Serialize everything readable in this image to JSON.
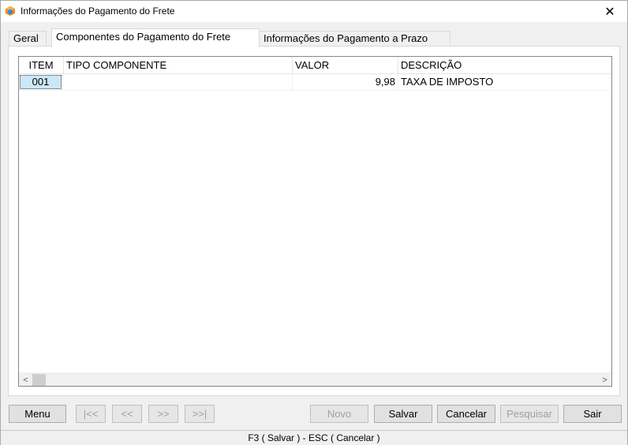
{
  "window": {
    "title": "Informações do Pagamento do Frete",
    "close_glyph": "✕"
  },
  "tabs": [
    {
      "label": "Geral"
    },
    {
      "label": "Componentes do Pagamento do Frete"
    },
    {
      "label": "Informações do Pagamento a Prazo"
    }
  ],
  "active_tab": "Componentes do Pagamento do Frete",
  "grid": {
    "columns": [
      "ITEM",
      "TIPO COMPONENTE",
      "VALOR",
      "DESCRIÇÃO"
    ],
    "rows": [
      {
        "item": "001",
        "tipo": "",
        "valor": "9,98",
        "descricao": "TAXA DE IMPOSTO"
      }
    ],
    "scroll_left_glyph": "<",
    "scroll_right_glyph": ">"
  },
  "buttons": {
    "menu": "Menu",
    "first": "|<<",
    "prev": "<<",
    "next": ">>",
    "last": ">>|",
    "novo": "Novo",
    "salvar": "Salvar",
    "cancelar": "Cancelar",
    "pesquisar": "Pesquisar",
    "sair": "Sair"
  },
  "status": {
    "text": "F3 ( Salvar )  -  ESC ( Cancelar )"
  },
  "colors": {
    "selection": "#cce8f6",
    "icon_orange": "#f08a24",
    "icon_blue": "#2b8fd6"
  }
}
